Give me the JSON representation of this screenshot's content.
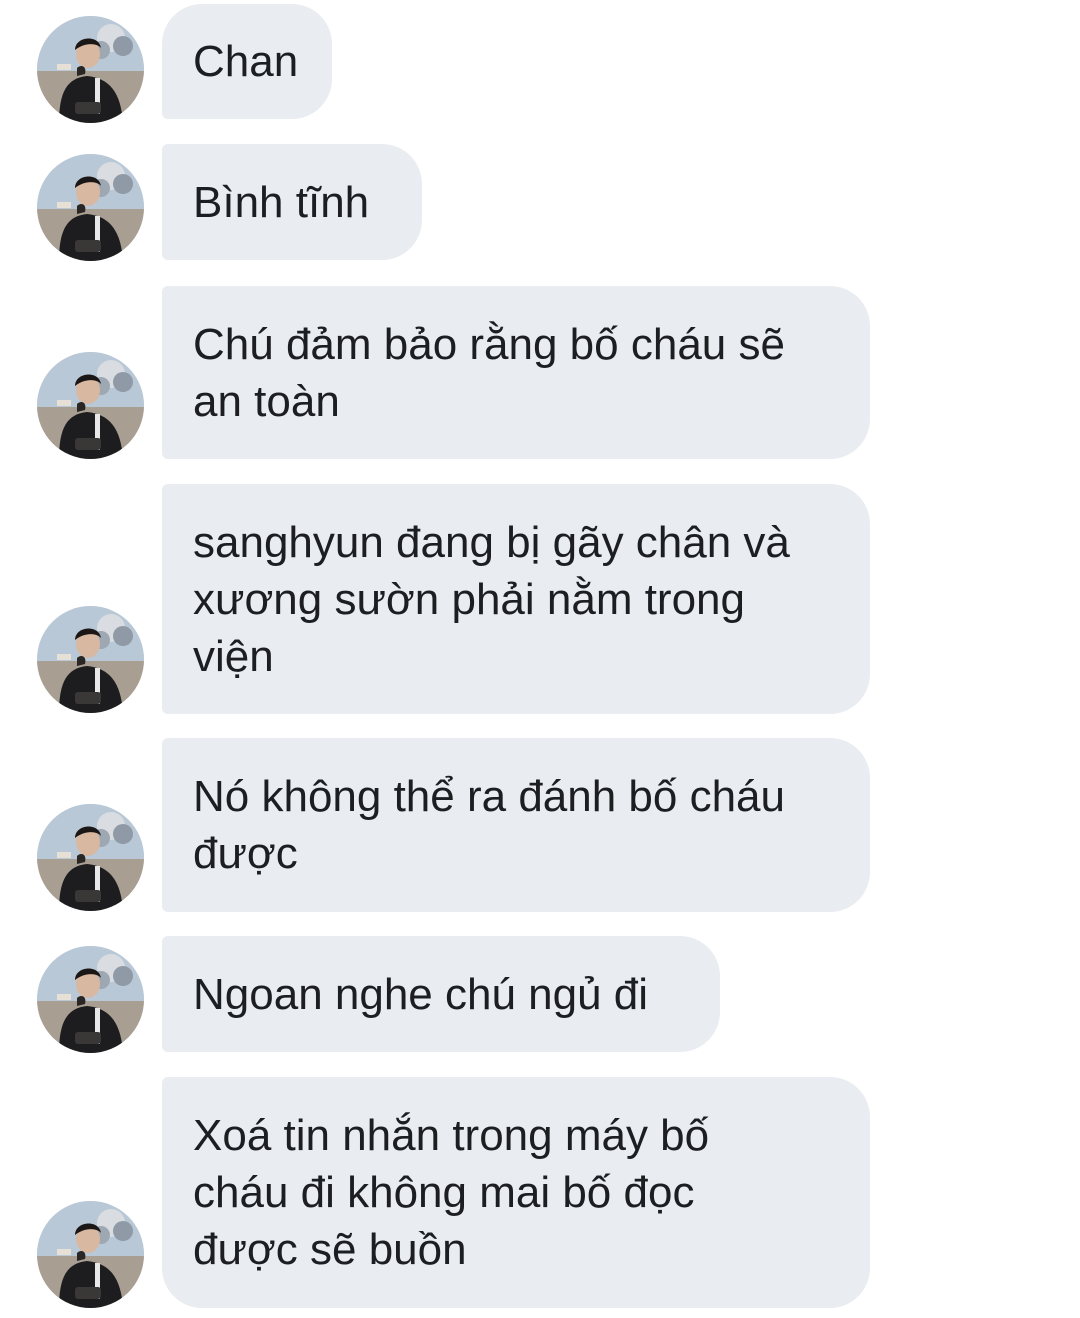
{
  "conversation": {
    "messages": [
      {
        "text": "Chan",
        "sender_avatar": "person-avatar"
      },
      {
        "text": "Bình tĩnh",
        "sender_avatar": "person-avatar"
      },
      {
        "text": "Chú đảm bảo rằng bố cháu sẽ\nan toàn",
        "sender_avatar": "person-avatar"
      },
      {
        "text": "sanghyun đang bị gãy chân và\nxương sườn phải nằm trong\nviện",
        "sender_avatar": "person-avatar"
      },
      {
        "text": "Nó không thể ra đánh bố cháu\nđược",
        "sender_avatar": "person-avatar"
      },
      {
        "text": "Ngoan nghe chú ngủ đi",
        "sender_avatar": "person-avatar"
      },
      {
        "text": "Xoá tin nhắn trong máy bố\ncháu đi không mai bố đọc\nđược sẽ buồn",
        "sender_avatar": "person-avatar"
      }
    ]
  },
  "colors": {
    "bubble_background": "#e9ecf0",
    "text": "#1c1e21",
    "page_background": "#ffffff"
  }
}
